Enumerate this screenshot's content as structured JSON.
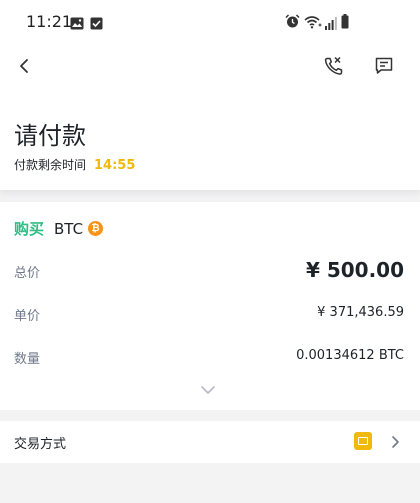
{
  "status_bar": {
    "time": "11:21",
    "left_icons": [
      "image-icon",
      "check-box-icon"
    ],
    "right_icons": [
      "alarm-icon",
      "wifi-icon",
      "signal-icon",
      "battery-icon"
    ]
  },
  "app_bar": {
    "back_icon": "back-chevron-icon",
    "actions": [
      "phone-icon",
      "chat-icon"
    ]
  },
  "header": {
    "title": "请付款",
    "timer_label": "付款剩余时间",
    "timer_value": "14:55"
  },
  "order": {
    "side": "购买",
    "coin": "BTC",
    "coin_icon": "bitcoin-icon",
    "total_label": "总价",
    "total_value": "¥ 500.00",
    "price_label": "单价",
    "price_value": "¥ 371,436.59",
    "quantity_label": "数量",
    "quantity_value": "0.00134612 BTC"
  },
  "payment": {
    "label": "交易方式",
    "icon": "payment-card-icon"
  },
  "colors": {
    "accent": "#f0b90b",
    "buy": "#2ebd85",
    "bitcoin": "#f7931a",
    "muted_text": "#707a8a",
    "background": "#f3f3f4"
  }
}
